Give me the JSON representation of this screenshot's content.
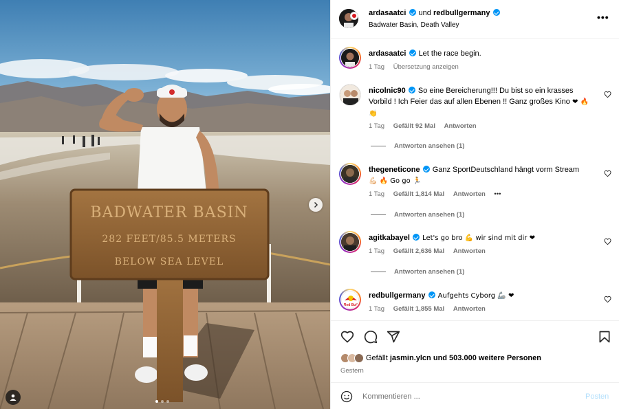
{
  "post": {
    "author": "ardasaatci",
    "conjunction": "und",
    "coauthor": "redbullgermany",
    "location": "Badwater Basin, Death Valley",
    "more_icon": "more-horizontal-icon"
  },
  "photo": {
    "sign_line1": "BADWATER BASIN",
    "sign_line2": "282 FEET/85.5 METERS",
    "sign_line3": "BELOW SEA LEVEL",
    "carousel_index": 1,
    "carousel_count": 3
  },
  "caption": {
    "username": "ardasaatci",
    "text": "Let the race begin.",
    "time": "1 Tag",
    "translate": "Übersetzung anzeigen"
  },
  "comments": [
    {
      "username": "nicolnic90",
      "text": "So eine Bereicherung!!! Du bist so ein krasses Vorbild ! Ich Feier das auf allen Ebenen !! Ganz großes Kino",
      "emoji": "❤ 🔥 👏",
      "time": "1 Tag",
      "likes": "Gefällt 92 Mal",
      "reply": "Antworten",
      "view_replies": "Antworten ansehen (1)"
    },
    {
      "username": "thegeneticone",
      "text": "Ganz SportDeutschland hängt vorm Stream",
      "emoji_after": "💪🏻 🔥 Go go 🏃",
      "time": "1 Tag",
      "likes": "Gefällt 1,814 Mal",
      "reply": "Antworten",
      "options": "•••",
      "view_replies": "Antworten ansehen (1)"
    },
    {
      "username": "agitkabayel",
      "text": "Let's go bro 💪 wir sind mit dir ❤",
      "time": "1 Tag",
      "likes": "Gefällt 2,636 Mal",
      "reply": "Antworten",
      "view_replies": "Antworten ansehen (1)"
    },
    {
      "username": "redbullgermany",
      "text": "Aufgehts Cyborg 🦾 ❤",
      "time": "1 Tag",
      "likes": "Gefällt 1,855 Mal",
      "reply": "Antworten"
    }
  ],
  "actions": {
    "likes_prefix": "Gefällt",
    "liked_by": "jasmin.ylcn",
    "likes_suffix": "und 503.000 weitere Personen",
    "date": "Gestern"
  },
  "composer": {
    "placeholder": "Kommentieren ...",
    "post_label": "Posten"
  },
  "colors": {
    "verified": "#0095f6",
    "muted": "#737373",
    "post_disabled": "#b2dffc",
    "heart_red": "#ed4956"
  }
}
